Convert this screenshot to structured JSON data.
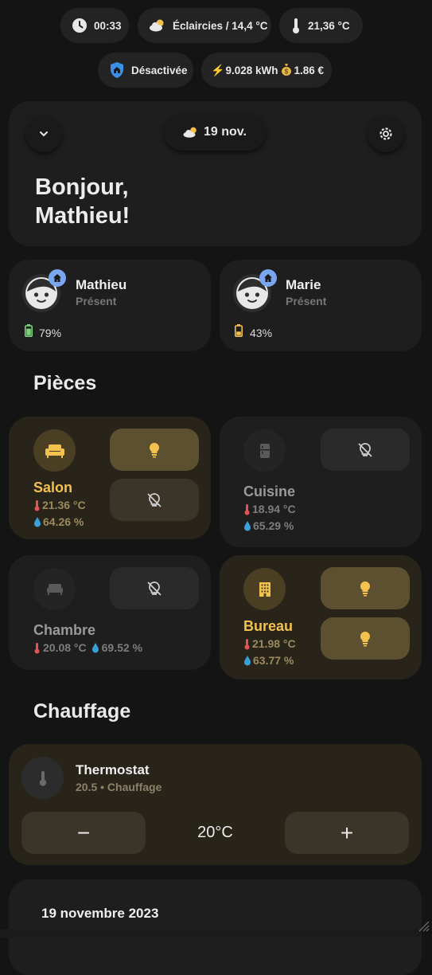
{
  "status_bar": {
    "time": "00:33",
    "weather": "Éclaircies / 14,4 °C",
    "temperature": "21,36 °C",
    "alarm": "Désactivée",
    "energy": "9.028 kWh",
    "cost": "1.86 €"
  },
  "header": {
    "date": "19 nov.",
    "greeting_line1": "Bonjour,",
    "greeting_line2": "Mathieu!"
  },
  "persons": [
    {
      "name": "Mathieu",
      "status": "Présent",
      "battery": "79%",
      "battery_level": 0.79
    },
    {
      "name": "Marie",
      "status": "Présent",
      "battery": "43%",
      "battery_level": 0.43
    }
  ],
  "sections": {
    "rooms": "Pièces",
    "heating": "Chauffage"
  },
  "rooms": [
    {
      "name": "Salon",
      "temperature": "21.36 °C",
      "humidity": "64.26 %",
      "active": true
    },
    {
      "name": "Cuisine",
      "temperature": "18.94 °C",
      "humidity": "65.29 %",
      "active": false
    },
    {
      "name": "Chambre",
      "temperature": "20.08 °C",
      "humidity": "69.52 %",
      "active": false
    },
    {
      "name": "Bureau",
      "temperature": "21.98 °C",
      "humidity": "63.77 %",
      "active": true
    }
  ],
  "thermostat": {
    "name": "Thermostat",
    "state": "20.5 • Chauffage",
    "setpoint": "20°C",
    "minus": "−",
    "plus": "+"
  },
  "calendar": {
    "date": "19 novembre 2023"
  },
  "colors": {
    "accent": "#f2c14e",
    "warm_card": "#29241a",
    "badge_blue": "#7aa6f0",
    "battery_green": "#7cd47c",
    "battery_yellow": "#f2c14e"
  }
}
